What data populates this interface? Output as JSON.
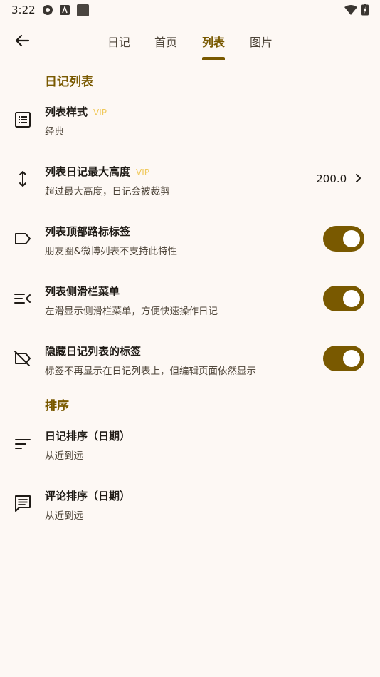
{
  "status_bar": {
    "time": "3:22"
  },
  "tabs": [
    {
      "label": "日记",
      "active": false
    },
    {
      "label": "首页",
      "active": false
    },
    {
      "label": "列表",
      "active": true
    },
    {
      "label": "图片",
      "active": false
    }
  ],
  "sections": [
    {
      "header": "日记列表",
      "items": [
        {
          "title": "列表样式",
          "badge": "VIP",
          "subtitle": "经典",
          "icon": "list-view-icon"
        },
        {
          "title": "列表日记最大高度",
          "badge": "VIP",
          "subtitle": "超过最大高度，日记会被裁剪",
          "value": "200.0",
          "icon": "vertical-resize-icon"
        },
        {
          "title": "列表顶部路标标签",
          "subtitle": "朋友圈&微博列表不支持此特性",
          "toggle": true,
          "icon": "label-icon"
        },
        {
          "title": "列表侧滑栏菜单",
          "subtitle": "左滑显示侧滑栏菜单，方便快速操作日记",
          "toggle": true,
          "icon": "menu-open-icon"
        },
        {
          "title": "隐藏日记列表的标签",
          "subtitle": "标签不再显示在日记列表上，但编辑页面依然显示",
          "toggle": true,
          "icon": "label-off-icon"
        }
      ]
    },
    {
      "header": "排序",
      "items": [
        {
          "title": "日记排序（日期）",
          "subtitle": "从近到远",
          "icon": "sort-icon"
        },
        {
          "title": "评论排序（日期）",
          "subtitle": "从近到远",
          "icon": "comment-icon"
        }
      ]
    }
  ],
  "colors": {
    "accent": "#795900",
    "vip": "#f0c95c",
    "background": "#fdf8f4"
  }
}
